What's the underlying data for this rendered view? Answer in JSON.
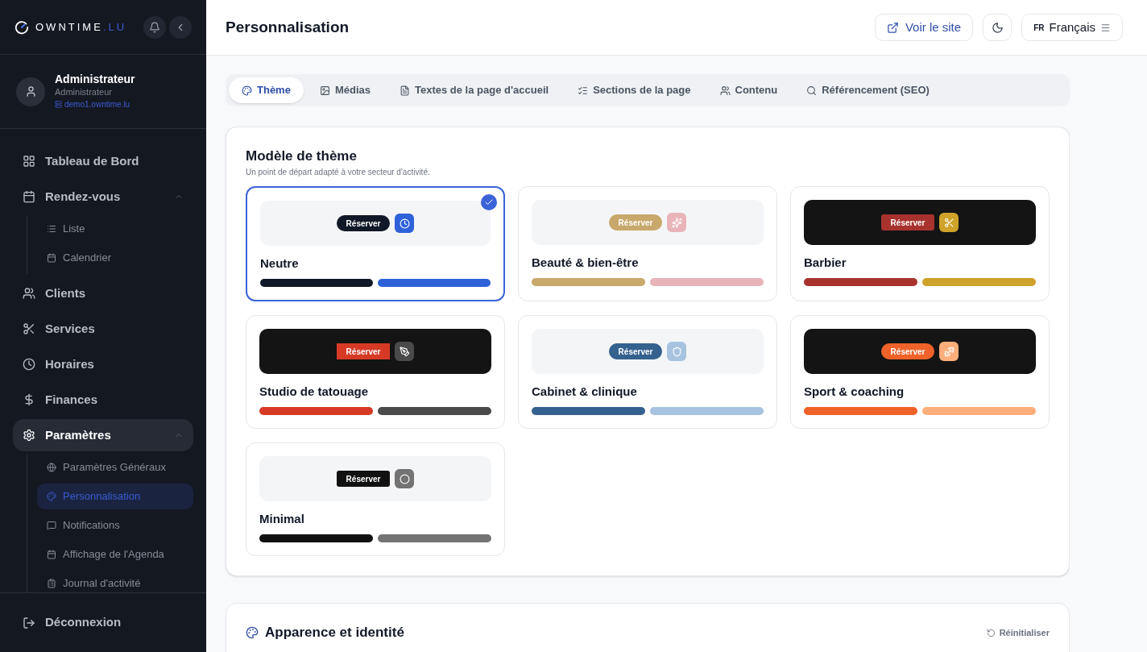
{
  "brand": {
    "name": "OWNTIME",
    "suffix": ".LU"
  },
  "user": {
    "name": "Administrateur",
    "role": "Administrateur",
    "site": "demo1.owntime.lu"
  },
  "sidebar": {
    "items": [
      {
        "label": "Tableau de Bord",
        "selected": false
      },
      {
        "label": "Rendez-vous",
        "selected": false,
        "expanded": true,
        "children": [
          {
            "label": "Liste",
            "selected": false
          },
          {
            "label": "Calendrier",
            "selected": false
          }
        ]
      },
      {
        "label": "Clients",
        "selected": false
      },
      {
        "label": "Services",
        "selected": false
      },
      {
        "label": "Horaires",
        "selected": false
      },
      {
        "label": "Finances",
        "selected": false
      },
      {
        "label": "Paramètres",
        "selected": true,
        "expanded": true,
        "children": [
          {
            "label": "Paramètres Généraux",
            "selected": false
          },
          {
            "label": "Personnalisation",
            "selected": true
          },
          {
            "label": "Notifications",
            "selected": false
          },
          {
            "label": "Affichage de l'Agenda",
            "selected": false
          },
          {
            "label": "Journal d'activité",
            "selected": false
          }
        ]
      }
    ],
    "logout": "Déconnexion"
  },
  "header": {
    "title": "Personnalisation",
    "view_site": "Voir le site",
    "language_code": "FR",
    "language": "Français"
  },
  "tabs": [
    {
      "label": "Thème",
      "selected": true
    },
    {
      "label": "Médias",
      "selected": false
    },
    {
      "label": "Textes de la page d'accueil",
      "selected": false
    },
    {
      "label": "Sections de la page",
      "selected": false
    },
    {
      "label": "Contenu",
      "selected": false
    },
    {
      "label": "Référencement (SEO)",
      "selected": false
    }
  ],
  "theme_section": {
    "title": "Modèle de thème",
    "subtitle": "Un point de départ adapté à votre secteur d'activité.",
    "themes": [
      {
        "name": "Neutre",
        "selected": true,
        "kind": "light",
        "button": {
          "label": "Réserver",
          "kind": "pill"
        },
        "swatches": [
          {
            "color": "#111827"
          },
          {
            "color": "#2f62d9"
          }
        ]
      },
      {
        "name": "Beauté & bien-être",
        "selected": false,
        "kind": "light",
        "button": {
          "label": "Réserver",
          "kind": "pill"
        },
        "swatches": [
          {
            "color": "#c8a86b"
          },
          {
            "color": "#e8b4ba"
          }
        ]
      },
      {
        "name": "Barbier",
        "selected": false,
        "kind": "dark",
        "button": {
          "label": "Réserver",
          "kind": "rounded"
        },
        "swatches": [
          {
            "color": "#a8322d"
          },
          {
            "color": "#cfa22a"
          }
        ]
      },
      {
        "name": "Studio de tatouage",
        "selected": false,
        "kind": "dark",
        "button": {
          "label": "Réserver",
          "kind": "square"
        },
        "swatches": [
          {
            "color": "#d63a25"
          },
          {
            "color": "#4a4a4a"
          }
        ]
      },
      {
        "name": "Cabinet & clinique",
        "selected": false,
        "kind": "light",
        "button": {
          "label": "Réserver",
          "kind": "pill"
        },
        "swatches": [
          {
            "color": "#35618f"
          },
          {
            "color": "#a8c3df"
          }
        ]
      },
      {
        "name": "Sport & coaching",
        "selected": false,
        "kind": "dark",
        "button": {
          "label": "Réserver",
          "kind": "pill"
        },
        "swatches": [
          {
            "color": "#f06229"
          },
          {
            "color": "#fdae7a"
          }
        ]
      },
      {
        "name": "Minimal",
        "selected": false,
        "kind": "light",
        "button": {
          "label": "Réserver",
          "kind": "rounded"
        },
        "swatches": [
          {
            "color": "#111111"
          },
          {
            "color": "#737373"
          }
        ]
      }
    ]
  },
  "appearance_section": {
    "title": "Apparence et identité",
    "reset": "Réinitialiser"
  }
}
